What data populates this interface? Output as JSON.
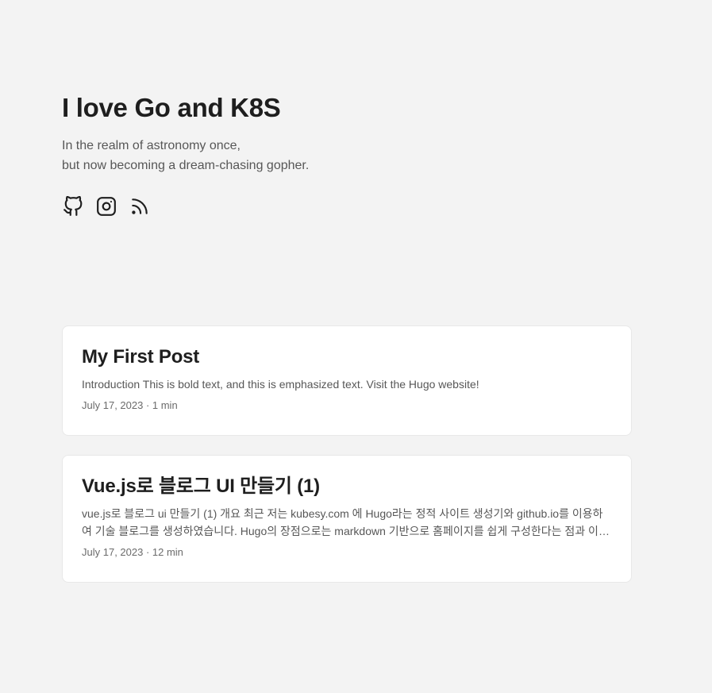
{
  "header": {
    "title": "I love Go and K8S",
    "description_line1": "In the realm of astronomy once,",
    "description_line2": "but now becoming a dream-chasing gopher."
  },
  "social": [
    {
      "name": "github-icon",
      "label": "GitHub"
    },
    {
      "name": "instagram-icon",
      "label": "Instagram"
    },
    {
      "name": "rss-icon",
      "label": "RSS"
    }
  ],
  "posts": [
    {
      "title": "My First Post",
      "summary": "Introduction This is bold text, and this is emphasized text. Visit the Hugo website!",
      "meta": "July 17, 2023 · 1 min"
    },
    {
      "title": "Vue.js로 블로그 UI 만들기 (1)",
      "summary": "vue.js로 블로그 ui 만들기 (1) 개요 최근 저는 kubesy.com 에 Hugo라는 정적 사이트 생성기와 github.io를 이용하여 기술 블로그를 생성하였습니다. Hugo의 장점으로는 markdown 기반으로 홈페이지를 쉽게 구성한다는 점과 이미 만들어...",
      "meta": "July 17, 2023 · 12 min"
    }
  ]
}
